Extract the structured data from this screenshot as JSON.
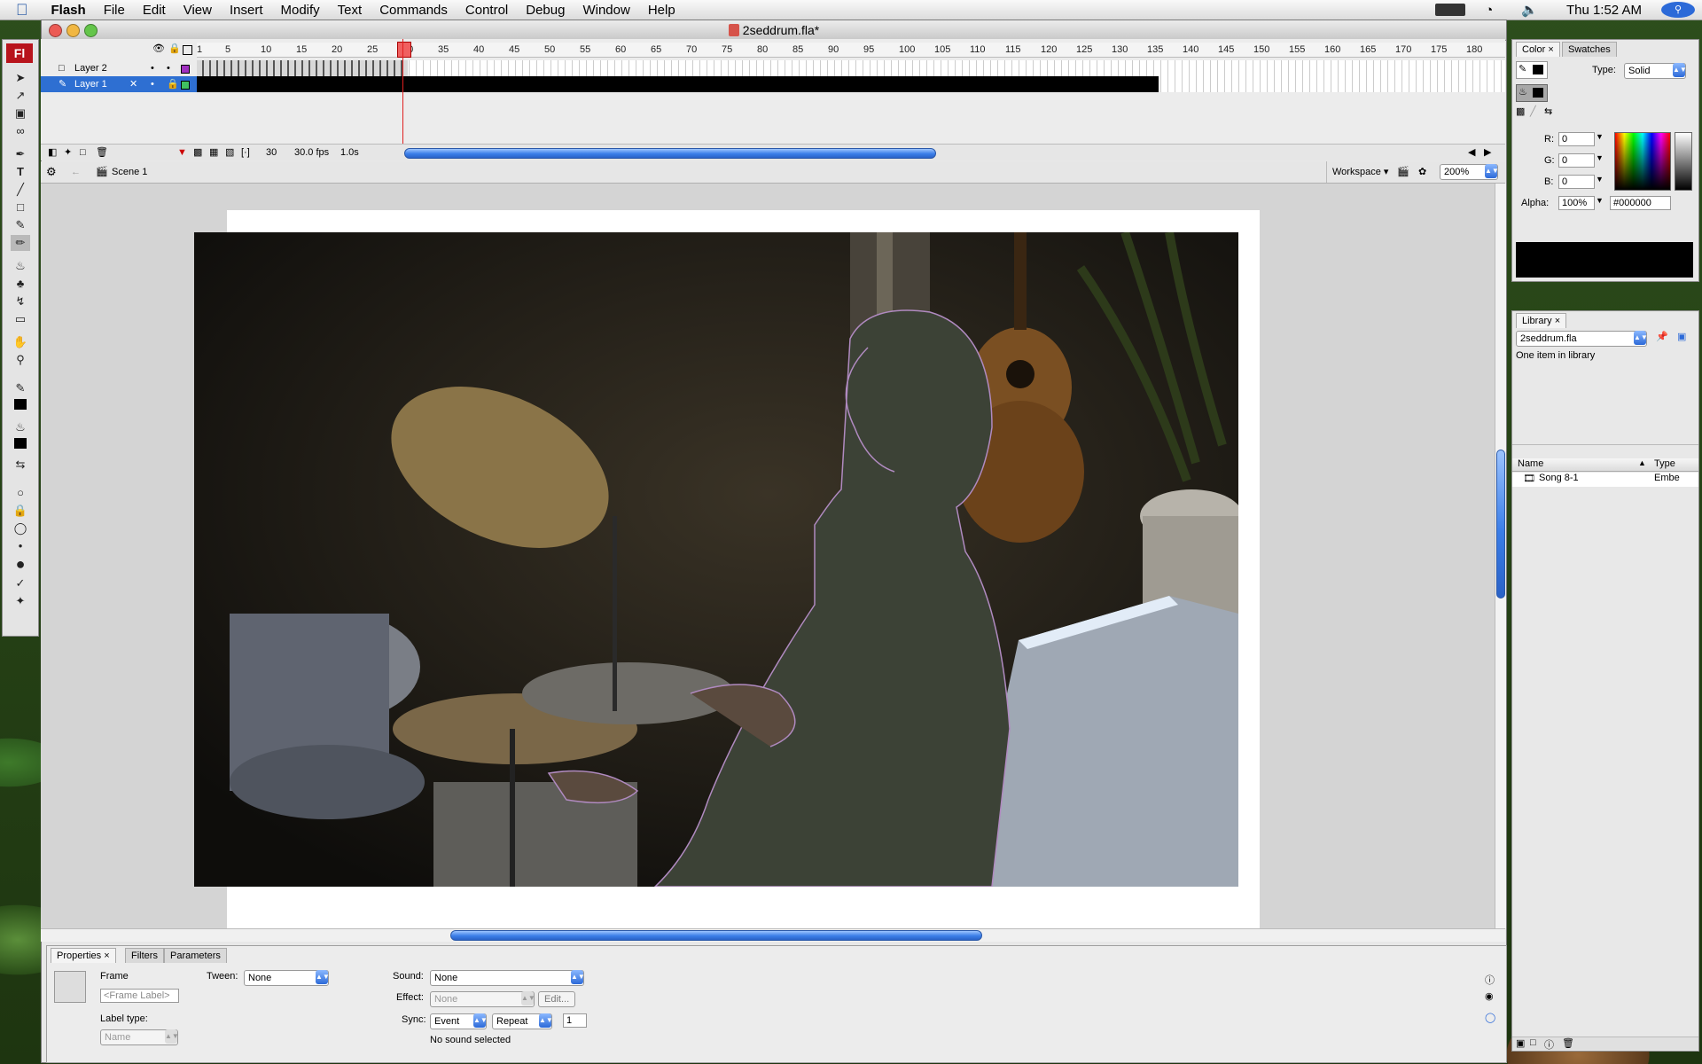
{
  "menubar": {
    "app": "Flash",
    "items": [
      "File",
      "Edit",
      "View",
      "Insert",
      "Modify",
      "Text",
      "Commands",
      "Control",
      "Debug",
      "Window",
      "Help"
    ],
    "clock": "Thu 1:52 AM"
  },
  "window": {
    "title": "2seddrum.fla*"
  },
  "toolbox": {
    "logo": "Fl"
  },
  "timeline": {
    "ruler": [
      "1",
      "5",
      "10",
      "15",
      "20",
      "25",
      "30",
      "35",
      "40",
      "45",
      "50",
      "55",
      "60",
      "65",
      "70",
      "75",
      "80",
      "85",
      "90",
      "95",
      "100",
      "105",
      "110",
      "115",
      "120",
      "125",
      "130",
      "135",
      "140",
      "145",
      "150",
      "155",
      "160",
      "165",
      "170",
      "175",
      "180"
    ],
    "layers": [
      {
        "name": "Layer 2",
        "selected": false
      },
      {
        "name": "Layer 1",
        "selected": true
      }
    ],
    "current_frame": "30",
    "fps": "30.0 fps",
    "elapsed": "1.0s"
  },
  "editbar": {
    "scene": "Scene 1",
    "workspace": "Workspace",
    "zoom": "200%"
  },
  "properties": {
    "tabs": [
      "Properties",
      "Filters",
      "Parameters"
    ],
    "frame_label": "Frame",
    "frame_placeholder": "<Frame Label>",
    "label_type": "Label type:",
    "label_type_value": "Name",
    "tween_label": "Tween:",
    "tween_value": "None",
    "sound_label": "Sound:",
    "sound_value": "None",
    "effect_label": "Effect:",
    "effect_value": "None",
    "edit_button": "Edit...",
    "sync_label": "Sync:",
    "sync_value": "Event",
    "repeat_value": "Repeat",
    "repeat_count": "1",
    "no_sound": "No sound selected"
  },
  "color_panel": {
    "tabs": [
      "Color",
      "Swatches"
    ],
    "type_label": "Type:",
    "type_value": "Solid",
    "r_label": "R:",
    "r": "0",
    "g_label": "G:",
    "g": "0",
    "b_label": "B:",
    "b": "0",
    "alpha_label": "Alpha:",
    "alpha": "100%",
    "hex": "#000000"
  },
  "library_panel": {
    "tab": "Library",
    "file": "2seddrum.fla",
    "count": "One item in library",
    "col_name": "Name",
    "col_type": "Type",
    "item_name": "Song 8-1",
    "item_type": "Embe"
  },
  "colors": {
    "accent": "#2e6fd2",
    "playhead": "#e02020",
    "logo": "#b8141c"
  }
}
